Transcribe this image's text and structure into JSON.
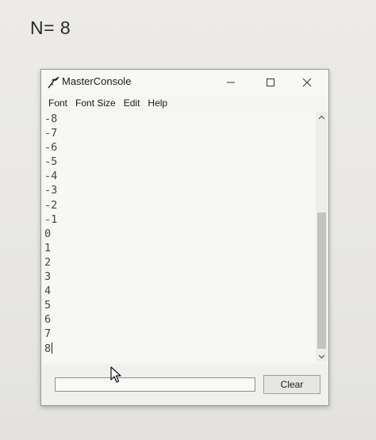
{
  "heading": "N= 8",
  "window": {
    "title": "MasterConsole",
    "app_icon": "feather-icon",
    "controls": {
      "minimize_icon": "minimize-icon",
      "maximize_icon": "maximize-icon",
      "close_icon": "close-icon"
    }
  },
  "menu": [
    "Font",
    "Font Size",
    "Edit",
    "Help"
  ],
  "console": {
    "lines": [
      "-8",
      "-7",
      "-6",
      "-5",
      "-4",
      "-3",
      "-2",
      "-1",
      "0",
      "1",
      "2",
      "3",
      "4",
      "5",
      "6",
      "7",
      "8"
    ],
    "scroll_position": 0.64
  },
  "input": {
    "value": ""
  },
  "clear_button": "Clear",
  "colors": {
    "background": "#ecebe8",
    "window": "#f5f5f3",
    "console_text": "#444444",
    "scroll_thumb": "#c3c3c1"
  }
}
